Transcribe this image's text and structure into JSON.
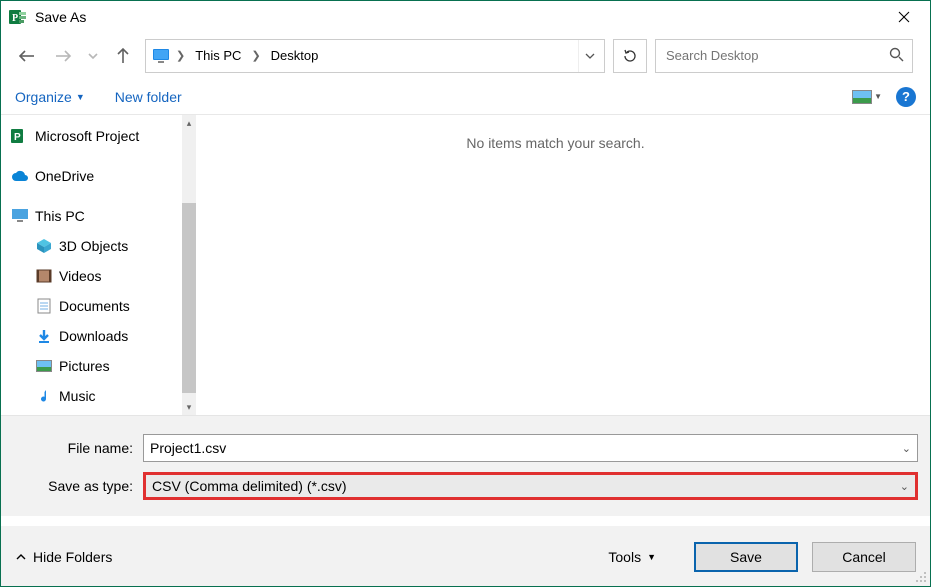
{
  "window": {
    "title": "Save As"
  },
  "breadcrumb": {
    "root": "This PC",
    "leaf": "Desktop"
  },
  "refresh_tooltip": "Refresh",
  "search": {
    "placeholder": "Search Desktop"
  },
  "toolbar": {
    "organize": "Organize",
    "new_folder": "New folder",
    "help": "?"
  },
  "tree": {
    "items": [
      {
        "label": "Microsoft Project"
      },
      {
        "label": "OneDrive"
      },
      {
        "label": "This PC"
      },
      {
        "label": "3D Objects"
      },
      {
        "label": "Videos"
      },
      {
        "label": "Documents"
      },
      {
        "label": "Downloads"
      },
      {
        "label": "Pictures"
      },
      {
        "label": "Music"
      }
    ]
  },
  "content": {
    "empty_message": "No items match your search."
  },
  "form": {
    "filename_label": "File name:",
    "filename_value": "Project1.csv",
    "savetype_label": "Save as type:",
    "savetype_value": "CSV (Comma delimited) (*.csv)"
  },
  "footer": {
    "hide_folders": "Hide Folders",
    "tools": "Tools",
    "save": "Save",
    "cancel": "Cancel"
  }
}
